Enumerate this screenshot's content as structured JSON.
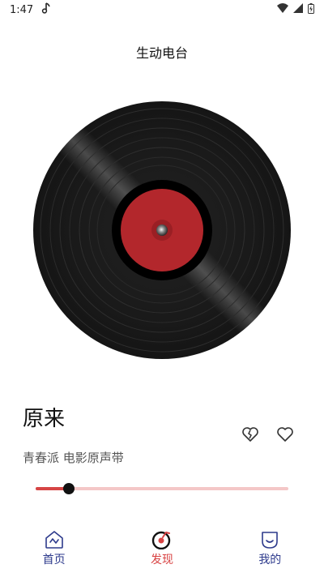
{
  "status_bar": {
    "time": "1:47"
  },
  "header": {
    "title": "生动电台"
  },
  "song": {
    "title": "原来",
    "subtitle": "青春派 电影原声带"
  },
  "player": {
    "progress": 0.133
  },
  "nav": {
    "home": "首页",
    "discover": "发现",
    "mine": "我的"
  },
  "colors": {
    "accent": "#d84343",
    "nav_text": "#2d3a8c",
    "track": "#f4c7c7",
    "record_label": "#b3272c"
  },
  "icons": {
    "status": [
      "music-note-icon",
      "wifi-icon",
      "signal-icon",
      "battery-icon"
    ],
    "actions": [
      "broken-heart-icon",
      "heart-icon"
    ],
    "nav": [
      "home-icon",
      "music-disc-icon",
      "profile-icon"
    ]
  }
}
